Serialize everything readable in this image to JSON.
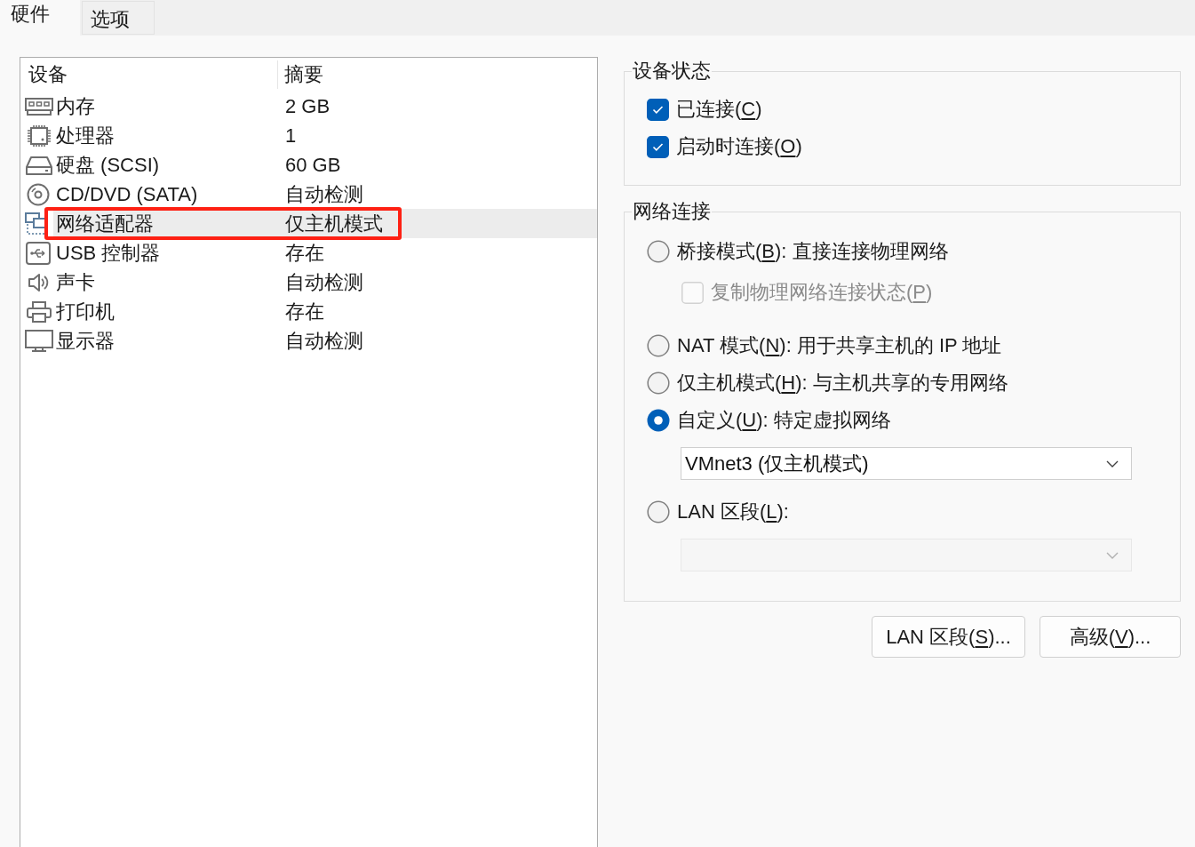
{
  "tabs": [
    {
      "label": "硬件",
      "selected": true
    },
    {
      "label": "选项",
      "selected": false
    }
  ],
  "device_table": {
    "columns": [
      "设备",
      "摘要"
    ],
    "rows": [
      {
        "kind": "memory",
        "device": "内存",
        "summary": "2 GB",
        "selected": false,
        "highlighted": false
      },
      {
        "kind": "processor",
        "device": "处理器",
        "summary": "1",
        "selected": false,
        "highlighted": false
      },
      {
        "kind": "disk",
        "device": "硬盘 (SCSI)",
        "summary": "60 GB",
        "selected": false,
        "highlighted": false
      },
      {
        "kind": "cdrom",
        "device": "CD/DVD (SATA)",
        "summary": "自动检测",
        "selected": false,
        "highlighted": false
      },
      {
        "kind": "network",
        "device": "网络适配器",
        "summary": "仅主机模式",
        "selected": true,
        "highlighted": true
      },
      {
        "kind": "usb",
        "device": "USB 控制器",
        "summary": "存在",
        "selected": false,
        "highlighted": false
      },
      {
        "kind": "sound",
        "device": "声卡",
        "summary": "自动检测",
        "selected": false,
        "highlighted": false
      },
      {
        "kind": "printer",
        "device": "打印机",
        "summary": "存在",
        "selected": false,
        "highlighted": false
      },
      {
        "kind": "display",
        "device": "显示器",
        "summary": "自动检测",
        "selected": false,
        "highlighted": false
      }
    ]
  },
  "device_status": {
    "title": "设备状态",
    "options": [
      {
        "text_before": "已连接(",
        "access_key": "C",
        "text_after": ")",
        "checked": true
      },
      {
        "text_before": "启动时连接(",
        "access_key": "O",
        "text_after": ")",
        "checked": true
      }
    ]
  },
  "network_connection": {
    "title": "网络连接",
    "options": [
      {
        "kind": "radio",
        "text_before": "桥接模式(",
        "access_key": "B",
        "text_after": "): 直接连接物理网络",
        "selected": false
      },
      {
        "kind": "checkbox",
        "text_before": "复制物理网络连接状态(",
        "access_key": "P",
        "text_after": ")",
        "checked": false,
        "disabled": true
      },
      {
        "kind": "radio",
        "text_before": "NAT 模式(",
        "access_key": "N",
        "text_after": "): 用于共享主机的 IP 地址",
        "selected": false
      },
      {
        "kind": "radio",
        "text_before": "仅主机模式(",
        "access_key": "H",
        "text_after": "): 与主机共享的专用网络",
        "selected": false
      },
      {
        "kind": "radio",
        "text_before": "自定义(",
        "access_key": "U",
        "text_after": "): 特定虚拟网络",
        "selected": true
      },
      {
        "kind": "dropdown",
        "value": "VMnet3 (仅主机模式)",
        "disabled": false
      },
      {
        "kind": "radio",
        "text_before": "LAN 区段(",
        "access_key": "L",
        "text_after": "):",
        "selected": false
      },
      {
        "kind": "dropdown",
        "disabled": true
      }
    ]
  },
  "buttons": [
    {
      "text_before": "LAN 区段(",
      "access_key": "S",
      "text_after": ")..."
    },
    {
      "text_before": "高级(",
      "access_key": "V",
      "text_after": ")..."
    }
  ]
}
